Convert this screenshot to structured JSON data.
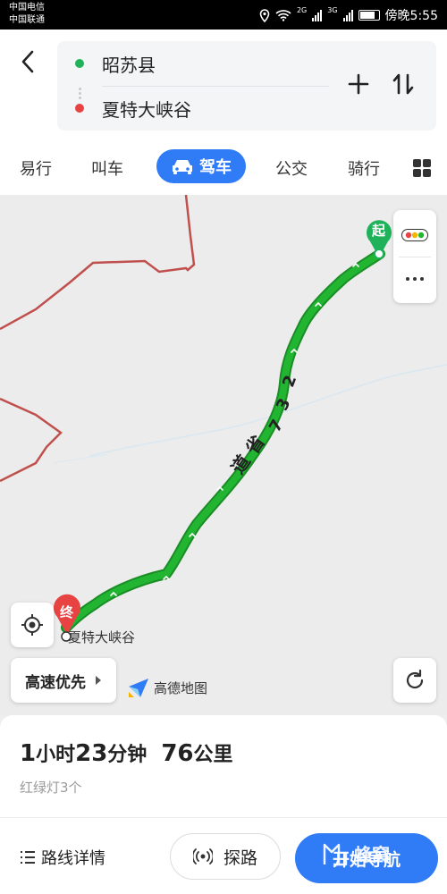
{
  "status_bar": {
    "carrier_1": "中国电信",
    "carrier_2": "中国联通",
    "net_1": "2G",
    "net_2": "3G",
    "time": "傍晚5:55"
  },
  "route": {
    "origin": "昭苏县",
    "destination": "夏特大峡谷"
  },
  "modes": {
    "yixing": "易行",
    "jiaoche": "叫车",
    "drive": "驾车",
    "bus": "公交",
    "ride": "骑行"
  },
  "map": {
    "start_pin": "起",
    "end_pin": "终",
    "end_label": "夏特大峡谷",
    "road_number": [
      "2",
      "3",
      "7"
    ],
    "road_suffix": [
      "省",
      "道"
    ],
    "route_pref": "高速优先",
    "logo_text": "高德地图",
    "colors": {
      "route": "#22b531",
      "border": "#c0504d",
      "start": "#1fb25a",
      "end": "#e84343"
    }
  },
  "summary": {
    "hours": "1",
    "hour_unit": "小时",
    "minutes": "23",
    "minute_unit": "分钟",
    "distance": "76",
    "distance_unit": "公里",
    "traffic_lights": "红绿灯3个"
  },
  "actions": {
    "details": "路线详情",
    "explore": "探路",
    "start": "开始导航"
  },
  "watermark": "蜂窝"
}
